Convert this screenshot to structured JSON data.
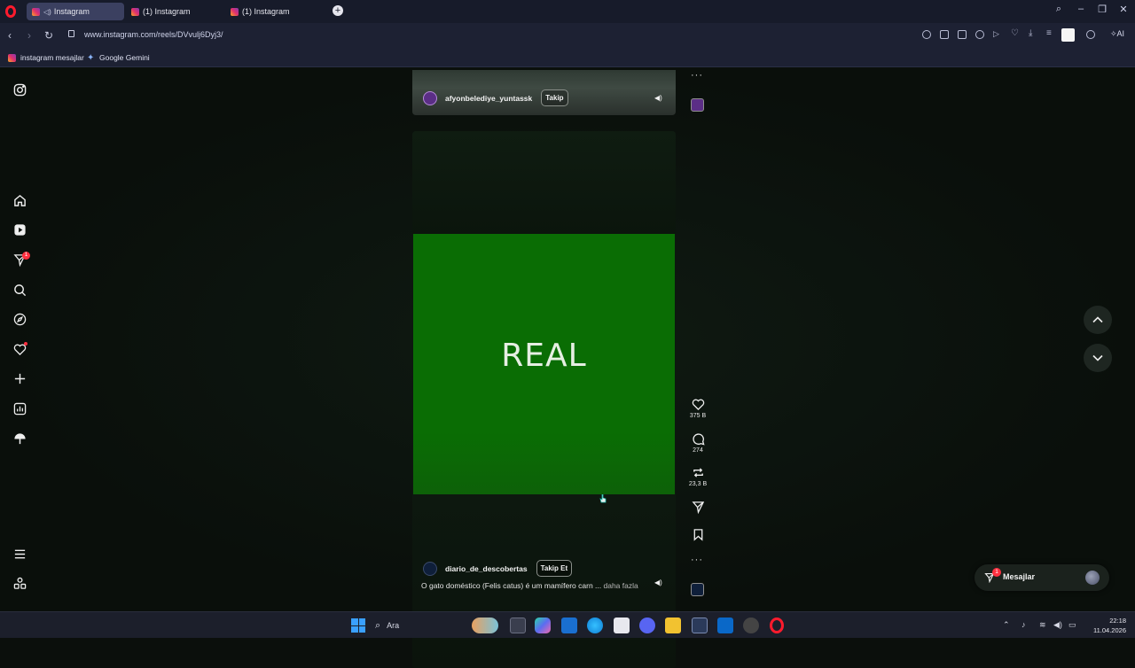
{
  "browser": {
    "tabs": [
      {
        "label": "Instagram",
        "active": true,
        "audio": true
      },
      {
        "label": "(1) Instagram",
        "active": false,
        "audio": false
      },
      {
        "label": "(1) Instagram",
        "active": false,
        "audio": false
      }
    ],
    "url": "www.instagram.com/reels/DVvulj6Dyj3/",
    "ai_label": "AI",
    "bookmarks": [
      {
        "label": "instagram mesajlar",
        "icon": "instagram-icon"
      },
      {
        "label": "Google Gemini",
        "icon": "gemini-icon"
      }
    ]
  },
  "sidebar": {
    "notification_count": "1",
    "items": [
      "instagram-logo-icon",
      "home-icon",
      "reels-icon",
      "direct-icon",
      "search-icon",
      "explore-icon",
      "heart-icon",
      "create-icon",
      "dashboard-icon",
      "threads-icon",
      "menu-icon",
      "more-apps-icon"
    ]
  },
  "reel_top": {
    "username": "afyonbelediye_yuntassk",
    "follow_label": "Takip"
  },
  "reel_main": {
    "overlay_text": "REAL",
    "username": "diario_de_descobertas",
    "follow_label": "Takip Et",
    "caption": "O gato doméstico (Felis catus) é um mamífero carn ...",
    "caption_more": "daha fazla"
  },
  "actions": {
    "likes": "375 B",
    "comments": "274",
    "reposts": "23,3 B"
  },
  "messages": {
    "label": "Mesajlar",
    "badge": "1"
  },
  "taskbar": {
    "search_label": "Ara",
    "time": "22:18",
    "date": "11.04.2026"
  },
  "colors": {
    "reel_green": "#0a6d04",
    "notification_red": "#ff3040",
    "tab_active": "#3b4060"
  }
}
